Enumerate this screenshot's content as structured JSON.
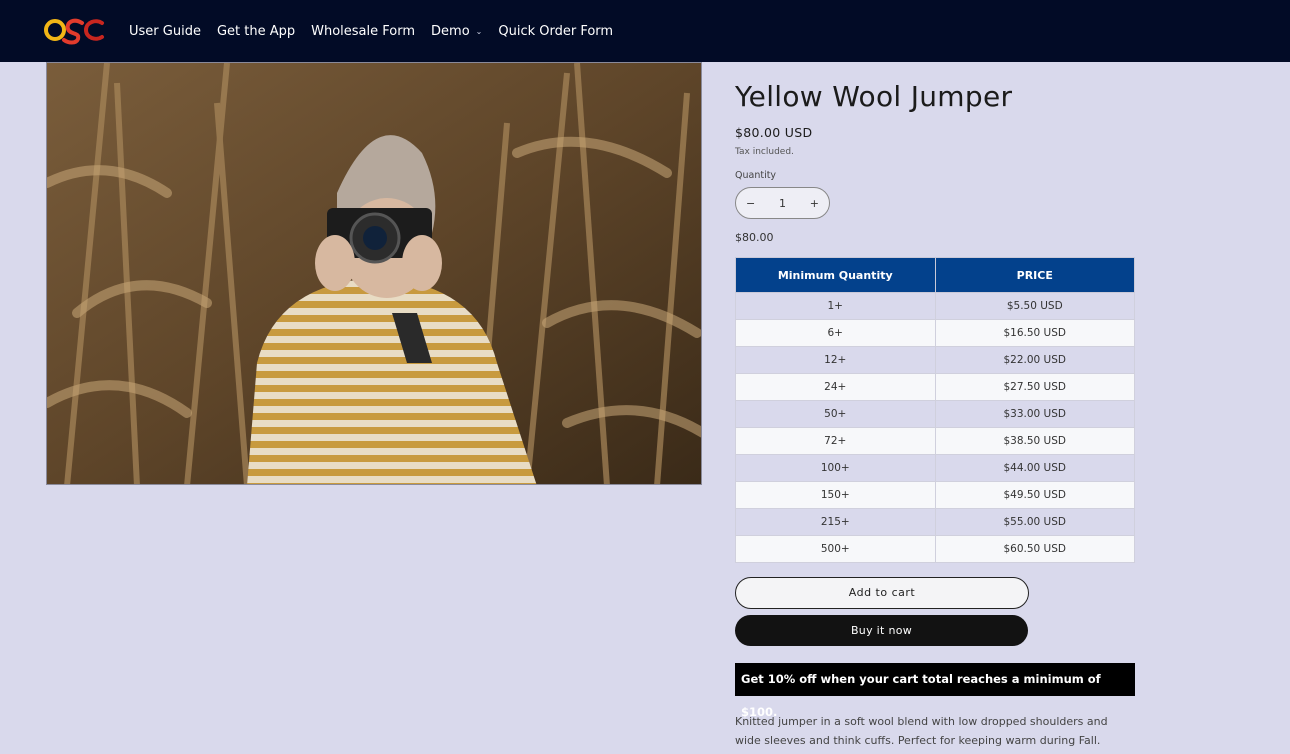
{
  "header": {
    "logo_text": "OSC",
    "nav": [
      {
        "label": "User Guide"
      },
      {
        "label": "Get the App"
      },
      {
        "label": "Wholesale Form"
      },
      {
        "label": "Demo"
      },
      {
        "label": "Quick Order Form"
      }
    ]
  },
  "product": {
    "title": "Yellow Wool Jumper",
    "price": "$80.00 USD",
    "tax_note": "Tax included.",
    "quantity_label": "Quantity",
    "quantity_value": "1",
    "minus_symbol": "−",
    "plus_symbol": "+",
    "subtotal": "$80.00",
    "image_icon": "photo-woman-camera-cornfield"
  },
  "tier_table": {
    "headers": [
      "Minimum Quantity",
      "PRICE"
    ],
    "rows": [
      [
        "1+",
        "$5.50 USD"
      ],
      [
        "6+",
        "$16.50 USD"
      ],
      [
        "12+",
        "$22.00 USD"
      ],
      [
        "24+",
        "$27.50 USD"
      ],
      [
        "50+",
        "$33.00 USD"
      ],
      [
        "72+",
        "$38.50 USD"
      ],
      [
        "100+",
        "$44.00 USD"
      ],
      [
        "150+",
        "$49.50 USD"
      ],
      [
        "215+",
        "$55.00 USD"
      ],
      [
        "500+",
        "$60.50 USD"
      ]
    ]
  },
  "actions": {
    "add_to_cart": "Add to cart",
    "buy_now": "Buy it now"
  },
  "promo": "Get 10% off when your cart total reaches a minimum of $100.",
  "description": "Knitted jumper in a soft wool blend with low dropped shoulders and wide sleeves and think cuffs. Perfect for keeping warm during Fall.",
  "colors": {
    "header_bg": "#020b26",
    "page_bg": "#d9d9ec",
    "table_header": "#03418c",
    "buy_button": "#121212"
  }
}
